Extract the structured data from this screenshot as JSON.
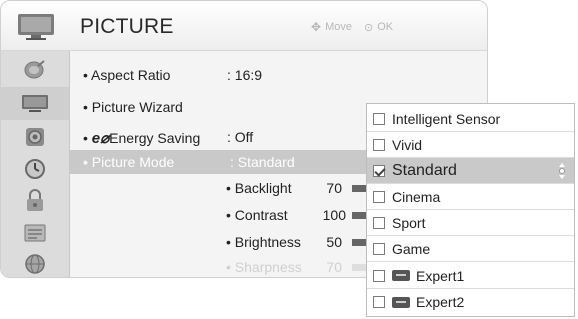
{
  "header": {
    "title": "PICTURE",
    "nav_hint_move": "Move",
    "nav_hint_ok": "OK",
    "icon": "tv-icon"
  },
  "sidebar": {
    "items": [
      {
        "name": "satellite-dish-icon"
      },
      {
        "name": "tv-icon"
      },
      {
        "name": "speaker-icon"
      },
      {
        "name": "clock-icon"
      },
      {
        "name": "lock-icon"
      },
      {
        "name": "options-icon"
      },
      {
        "name": "globe-icon"
      }
    ],
    "active_index": 1
  },
  "menu": {
    "rows": [
      {
        "label": "Aspect Ratio",
        "value": ": 16:9"
      },
      {
        "label": "Picture Wizard",
        "value": ""
      },
      {
        "label": "Energy Saving",
        "logo": "e",
        "value": ": Off"
      },
      {
        "label": "Picture Mode",
        "value": ": Standard"
      }
    ],
    "sub_items": [
      {
        "label": "• Backlight",
        "value": "70"
      },
      {
        "label": "• Contrast",
        "value": "100"
      },
      {
        "label": "• Brightness",
        "value": "50"
      },
      {
        "label": "• Sharpness",
        "value": "70"
      }
    ]
  },
  "dropdown": {
    "options": [
      {
        "label": "Intelligent Sensor",
        "checked": false
      },
      {
        "label": "Vivid",
        "checked": false
      },
      {
        "label": "Standard",
        "checked": true
      },
      {
        "label": "Cinema",
        "checked": false
      },
      {
        "label": "Sport",
        "checked": false
      },
      {
        "label": "Game",
        "checked": false
      },
      {
        "label": "Expert1",
        "checked": false,
        "isf": true
      },
      {
        "label": "Expert2",
        "checked": false,
        "isf": true
      }
    ],
    "selected_index": 2
  },
  "colors": {
    "selected_bg": "#c9c9c9",
    "panel_bg": "#f4f4f4",
    "sidebar_bg": "#dcdcdc"
  }
}
